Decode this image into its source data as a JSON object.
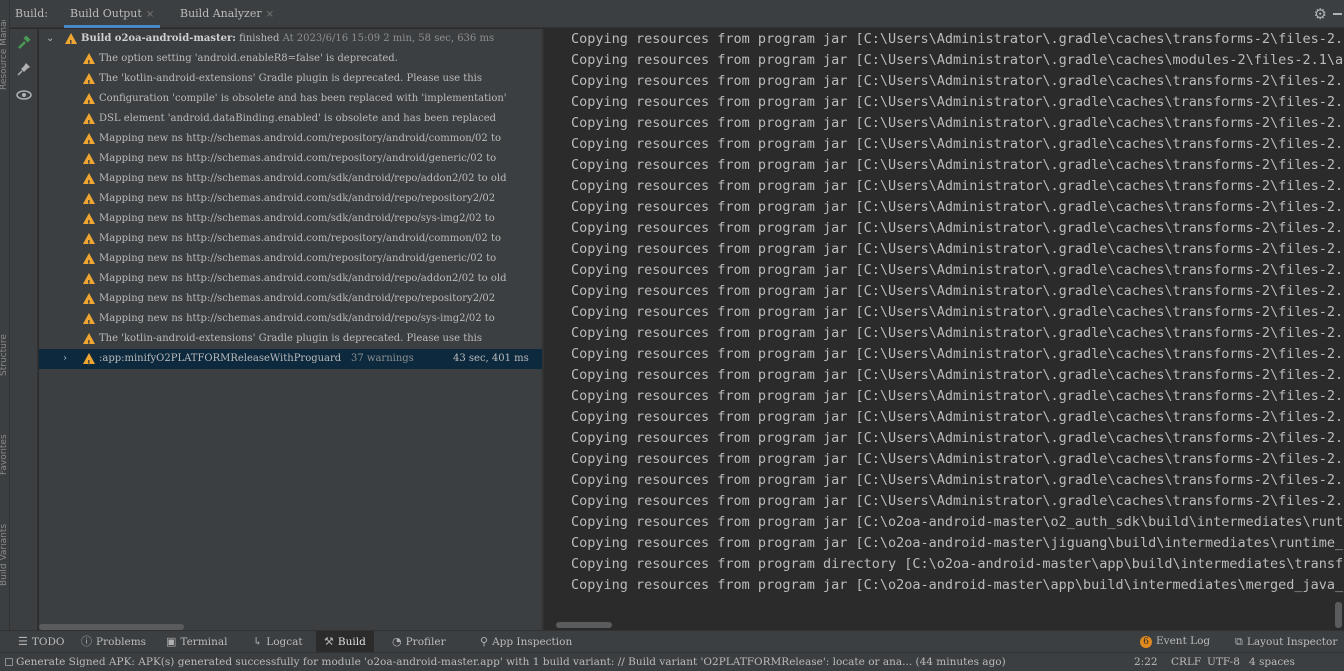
{
  "left_stripe": {
    "labels": [
      "Resource Manager",
      "Structure",
      "Favorites",
      "Build Variants"
    ]
  },
  "header": {
    "label": "Build:",
    "tabs": [
      {
        "label": "Build Output",
        "active": true
      },
      {
        "label": "Build Analyzer",
        "active": false
      }
    ],
    "close_glyph": "×",
    "icons": [
      "gear-icon",
      "minimize-icon"
    ]
  },
  "toolbar": {
    "icons": [
      "hammer-icon",
      "pin-icon",
      "eye-icon"
    ]
  },
  "tree": {
    "root": {
      "title": "Build o2oa-android-master:",
      "status": "finished",
      "time": "At 2023/6/16 15:09",
      "duration": "2 min, 58 sec, 636 ms"
    },
    "warnings": [
      "The option setting 'android.enableR8=false' is deprecated.",
      "The 'kotlin-android-extensions' Gradle plugin is deprecated. Please use this",
      "Configuration 'compile' is obsolete and has been replaced with 'implementation'",
      "DSL element 'android.dataBinding.enabled' is obsolete and has been replaced",
      "Mapping new ns http://schemas.android.com/repository/android/common/02 to",
      "Mapping new ns http://schemas.android.com/repository/android/generic/02 to",
      "Mapping new ns http://schemas.android.com/sdk/android/repo/addon2/02 to old",
      "Mapping new ns http://schemas.android.com/sdk/android/repo/repository2/02",
      "Mapping new ns http://schemas.android.com/sdk/android/repo/sys-img2/02 to",
      "Mapping new ns http://schemas.android.com/repository/android/common/02 to",
      "Mapping new ns http://schemas.android.com/repository/android/generic/02 to",
      "Mapping new ns http://schemas.android.com/sdk/android/repo/addon2/02 to old",
      "Mapping new ns http://schemas.android.com/sdk/android/repo/repository2/02",
      "Mapping new ns http://schemas.android.com/sdk/android/repo/sys-img2/02 to",
      "The 'kotlin-android-extensions' Gradle plugin is deprecated. Please use this"
    ],
    "task": {
      "name": ":app:minifyO2PLATFORMReleaseWithProguard",
      "warnings": "37 warnings",
      "duration": "43 sec, 401 ms"
    }
  },
  "console": {
    "lines": [
      "Copying resources from program jar [C:\\Users\\Administrator\\.gradle\\caches\\transforms-2\\files-2.",
      "Copying resources from program jar [C:\\Users\\Administrator\\.gradle\\caches\\modules-2\\files-2.1\\a",
      "Copying resources from program jar [C:\\Users\\Administrator\\.gradle\\caches\\transforms-2\\files-2.",
      "Copying resources from program jar [C:\\Users\\Administrator\\.gradle\\caches\\transforms-2\\files-2.",
      "Copying resources from program jar [C:\\Users\\Administrator\\.gradle\\caches\\transforms-2\\files-2.",
      "Copying resources from program jar [C:\\Users\\Administrator\\.gradle\\caches\\transforms-2\\files-2.",
      "Copying resources from program jar [C:\\Users\\Administrator\\.gradle\\caches\\transforms-2\\files-2.",
      "Copying resources from program jar [C:\\Users\\Administrator\\.gradle\\caches\\transforms-2\\files-2.",
      "Copying resources from program jar [C:\\Users\\Administrator\\.gradle\\caches\\transforms-2\\files-2.",
      "Copying resources from program jar [C:\\Users\\Administrator\\.gradle\\caches\\transforms-2\\files-2.",
      "Copying resources from program jar [C:\\Users\\Administrator\\.gradle\\caches\\transforms-2\\files-2.",
      "Copying resources from program jar [C:\\Users\\Administrator\\.gradle\\caches\\transforms-2\\files-2.",
      "Copying resources from program jar [C:\\Users\\Administrator\\.gradle\\caches\\transforms-2\\files-2.",
      "Copying resources from program jar [C:\\Users\\Administrator\\.gradle\\caches\\transforms-2\\files-2.",
      "Copying resources from program jar [C:\\Users\\Administrator\\.gradle\\caches\\transforms-2\\files-2.",
      "Copying resources from program jar [C:\\Users\\Administrator\\.gradle\\caches\\transforms-2\\files-2.",
      "Copying resources from program jar [C:\\Users\\Administrator\\.gradle\\caches\\transforms-2\\files-2.",
      "Copying resources from program jar [C:\\Users\\Administrator\\.gradle\\caches\\transforms-2\\files-2.",
      "Copying resources from program jar [C:\\Users\\Administrator\\.gradle\\caches\\transforms-2\\files-2.",
      "Copying resources from program jar [C:\\Users\\Administrator\\.gradle\\caches\\transforms-2\\files-2.",
      "Copying resources from program jar [C:\\Users\\Administrator\\.gradle\\caches\\transforms-2\\files-2.",
      "Copying resources from program jar [C:\\Users\\Administrator\\.gradle\\caches\\transforms-2\\files-2.",
      "Copying resources from program jar [C:\\Users\\Administrator\\.gradle\\caches\\transforms-2\\files-2.",
      "Copying resources from program jar [C:\\o2oa-android-master\\o2_auth_sdk\\build\\intermediates\\runt",
      "Copying resources from program jar [C:\\o2oa-android-master\\jiguang\\build\\intermediates\\runtime_",
      "Copying resources from program directory [C:\\o2oa-android-master\\app\\build\\intermediates\\transf",
      "Copying resources from program jar [C:\\o2oa-android-master\\app\\build\\intermediates\\merged_java_"
    ]
  },
  "bottom_tabs": {
    "left": [
      {
        "label": "TODO",
        "icon": "list-icon",
        "active": false
      },
      {
        "label": "Problems",
        "icon": "info-icon",
        "active": false
      },
      {
        "label": "Terminal",
        "icon": "terminal-icon",
        "active": false
      },
      {
        "label": "Logcat",
        "icon": "logcat-icon",
        "active": false
      },
      {
        "label": "Build",
        "icon": "hammer-icon",
        "active": true
      },
      {
        "label": "Profiler",
        "icon": "gauge-icon",
        "active": false
      },
      {
        "label": "App Inspection",
        "icon": "inspection-icon",
        "active": false
      }
    ],
    "right": [
      {
        "label": "Event Log",
        "icon": "event-log-icon",
        "badge": "6"
      },
      {
        "label": "Layout Inspector",
        "icon": "layout-inspector-icon"
      }
    ]
  },
  "status_bar": {
    "message": "Generate Signed APK: APK(s) generated successfully for module 'o2oa-android-master.app' with 1 build variant: // Build variant 'O2PLATFORMRelease': locate or ana... (44 minutes ago)",
    "position": "2:22",
    "line_separator": "CRLF",
    "encoding": "UTF-8",
    "indent": "4 spaces"
  },
  "colors": {
    "panel_bg": "#3c3f41",
    "console_bg": "#2b2b2b",
    "warning": "#f0a732",
    "selection": "#0d293e",
    "accent": "#4a88c7",
    "build_icon": "#499c54"
  }
}
